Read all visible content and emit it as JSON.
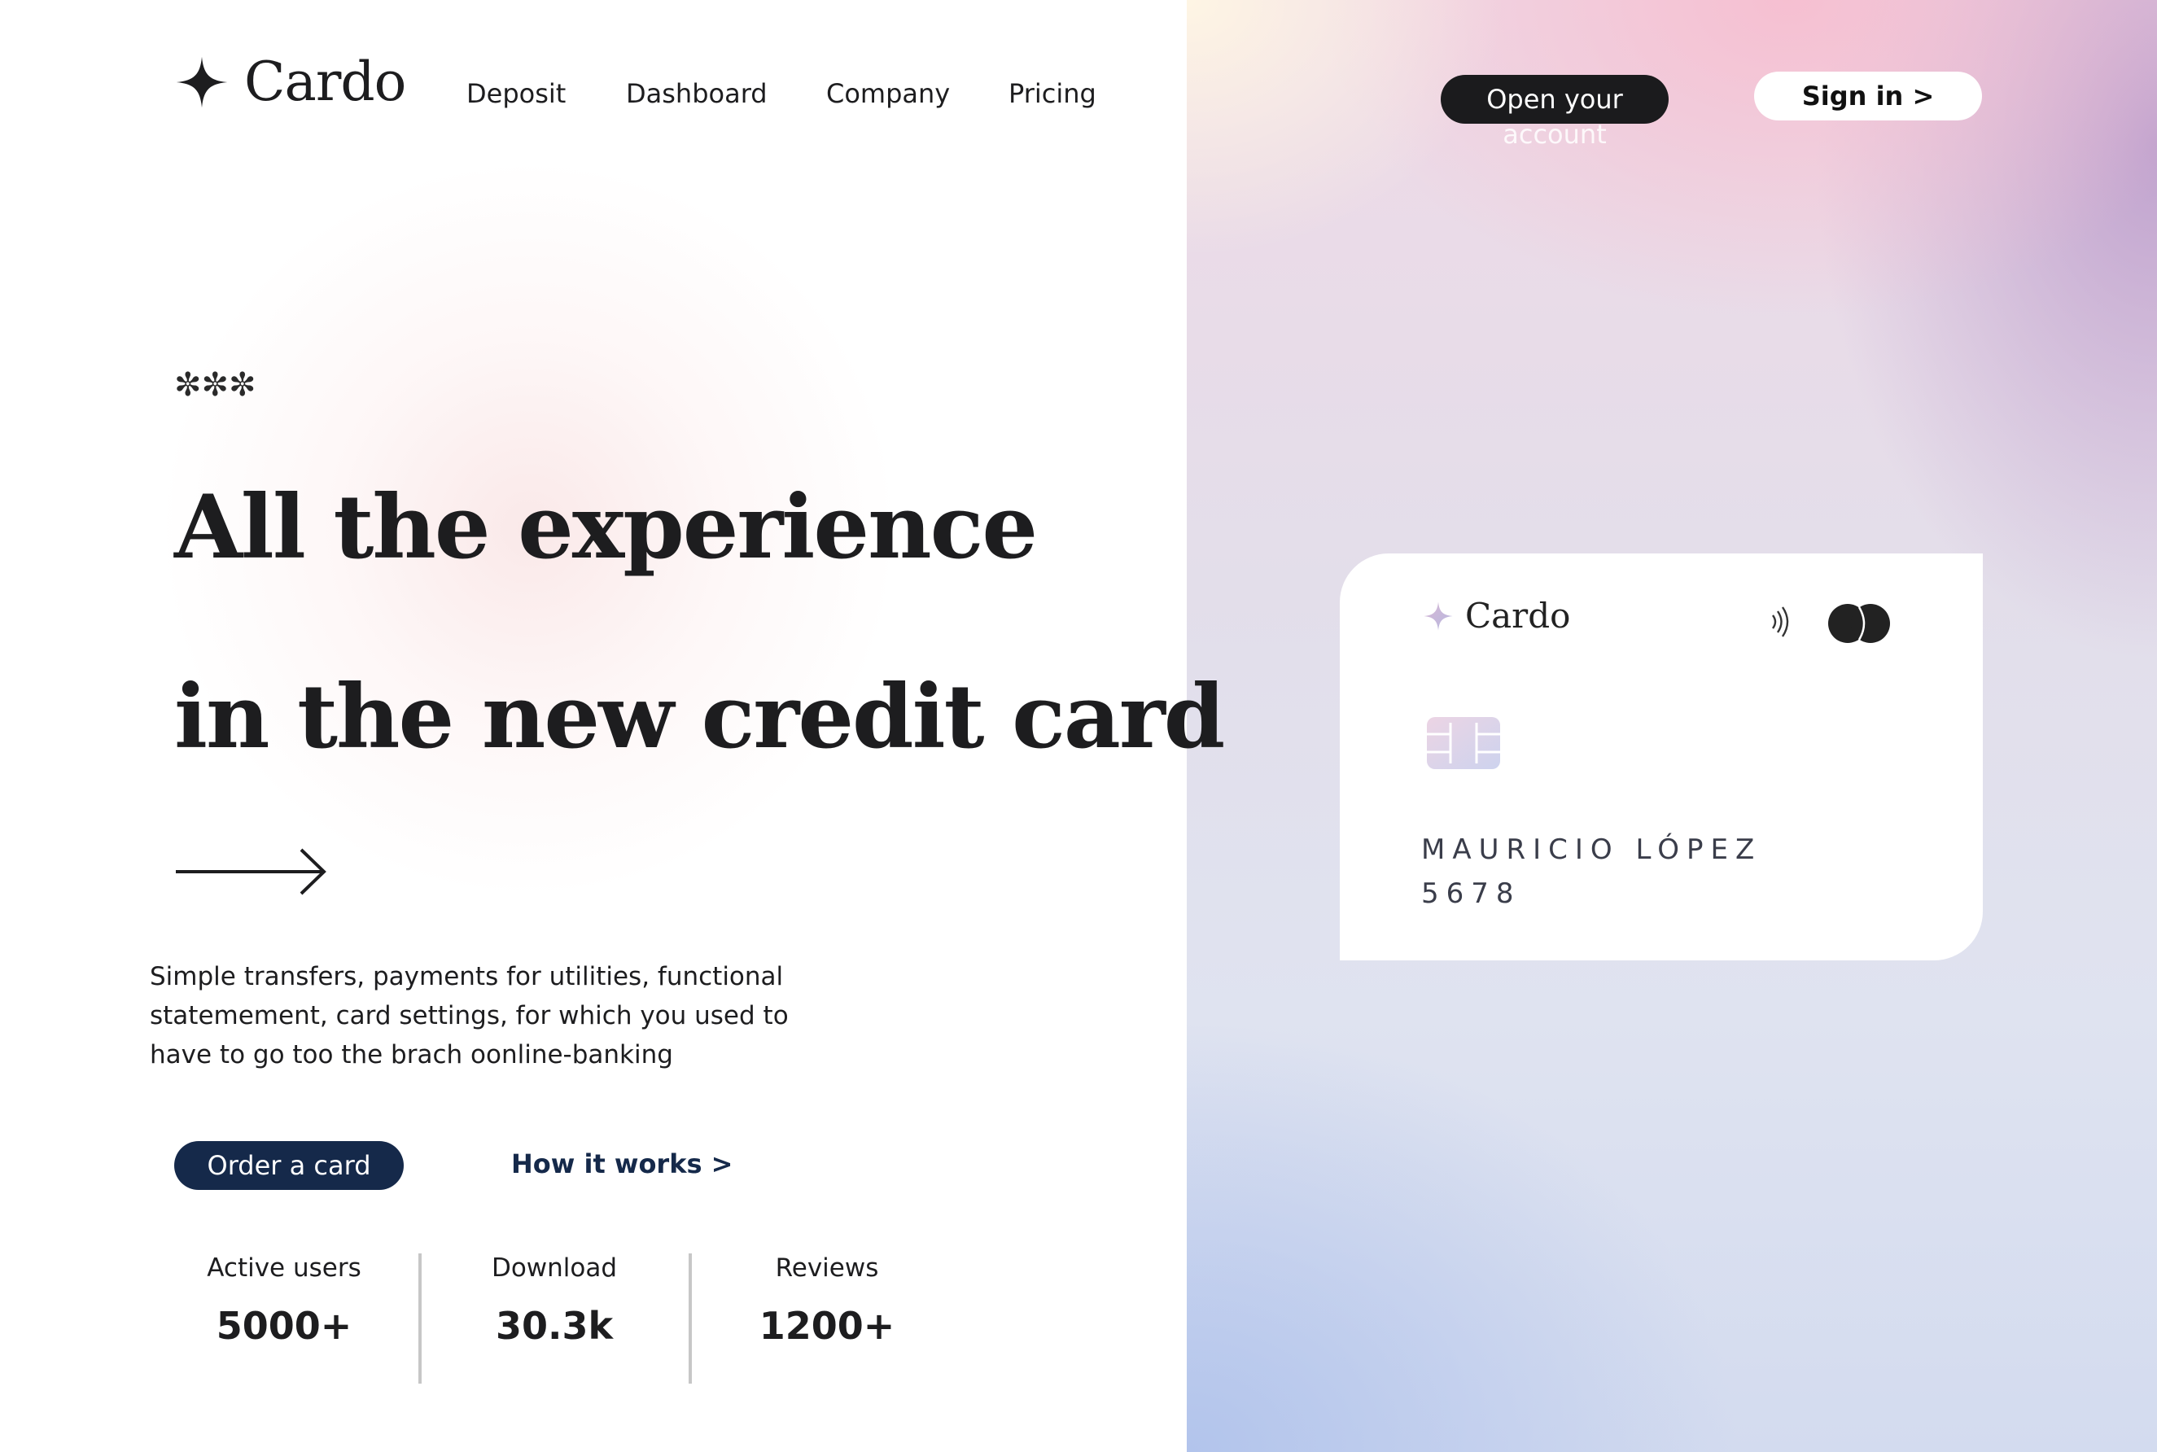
{
  "brand": {
    "name": "Cardo",
    "icon": "four-point-star-icon"
  },
  "nav": {
    "items": [
      {
        "label": "Deposit"
      },
      {
        "label": "Dashboard"
      },
      {
        "label": "Company"
      },
      {
        "label": "Pricing"
      }
    ]
  },
  "header": {
    "open_account_label": "Open your",
    "open_account_overflow": "account",
    "sign_in_label": "Sign in >"
  },
  "hero": {
    "decor": "✼✼✼",
    "headline_line1_light": "All the ",
    "headline_line1_bold": "experience",
    "headline_line2": "in the new credit card",
    "description": "Simple transfers, payments for utilities, functional statemement, card settings, for which you used to have to go too the brach oonline-banking",
    "order_button": "Order a card",
    "how_link": "How it works >"
  },
  "stats": [
    {
      "label": "Active users",
      "value": "5000+"
    },
    {
      "label": "Download",
      "value": "30.3k"
    },
    {
      "label": "Reviews",
      "value": "1200+"
    }
  ],
  "card": {
    "brand": "Cardo",
    "holder": "MAURICIO LÓPEZ",
    "number": "5678",
    "icons": [
      "contactless-icon",
      "mastercard-icon",
      "chip-icon"
    ]
  },
  "colors": {
    "dark": "#1b1b1d",
    "navy": "#15294a",
    "card_text": "#3a3d4a",
    "divider": "#c7c7c7"
  }
}
